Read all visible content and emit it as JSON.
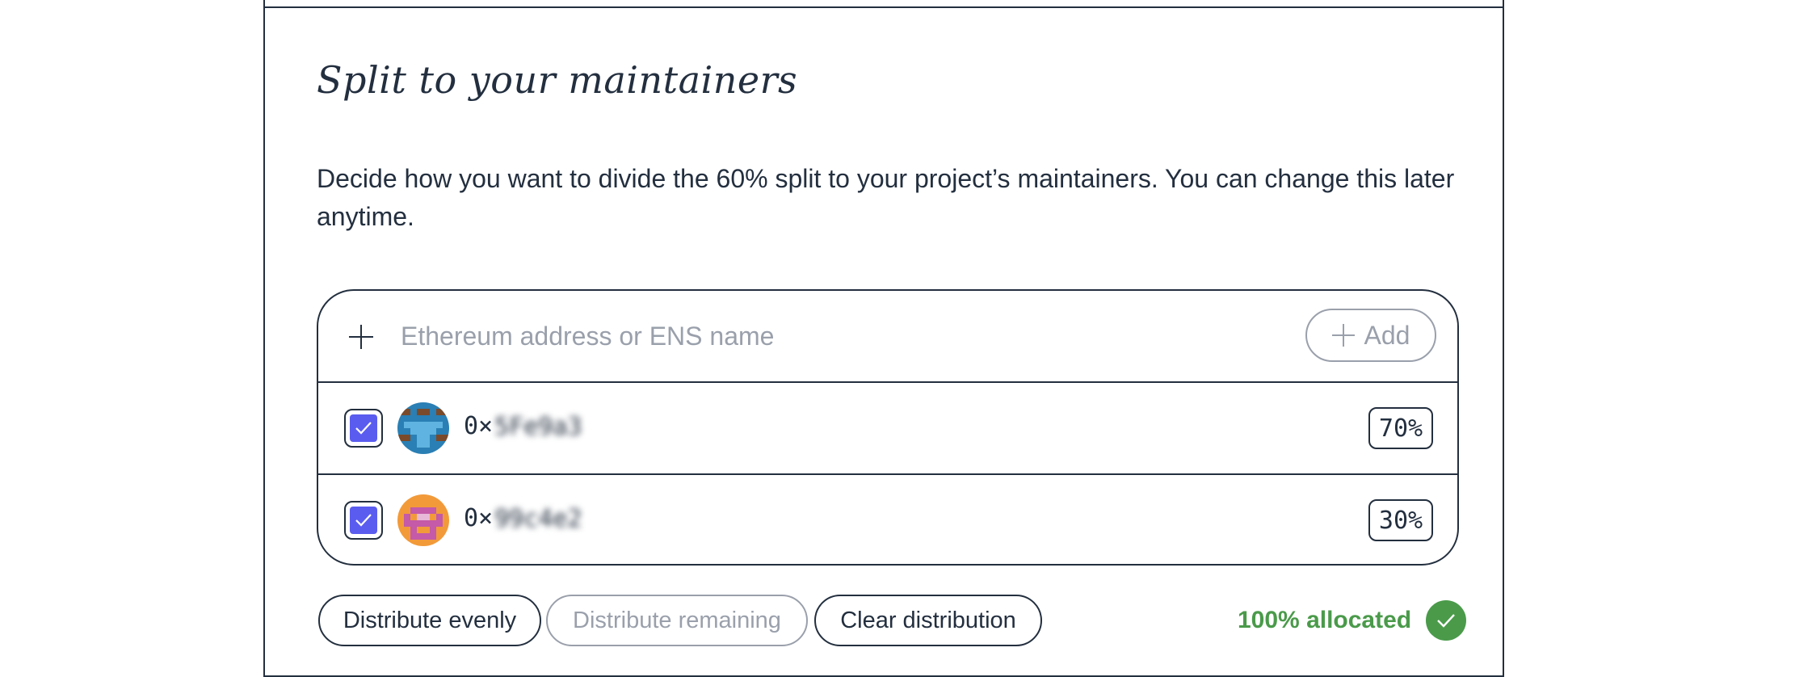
{
  "section": {
    "title": "Split to your maintainers",
    "description": "Decide how you want to divide the 60% split to your project’s maintainers. You can change this later anytime."
  },
  "add_row": {
    "placeholder": "Ethereum address or ENS name",
    "add_label": "Add"
  },
  "maintainers": [
    {
      "address_prefix": "0×",
      "address_hidden": "5Fe9a3",
      "percent": "70%",
      "checked": true
    },
    {
      "address_prefix": "0×",
      "address_hidden": "99c4e2",
      "percent": "30%",
      "checked": true
    }
  ],
  "actions": {
    "distribute_evenly": "Distribute evenly",
    "distribute_remaining": "Distribute remaining",
    "clear_distribution": "Clear distribution"
  },
  "status": {
    "text": "100% allocated"
  },
  "colors": {
    "ink": "#232f3f",
    "checkbox": "#5a5cf0",
    "success": "#4a9a4a",
    "muted": "#9aa0ab"
  }
}
